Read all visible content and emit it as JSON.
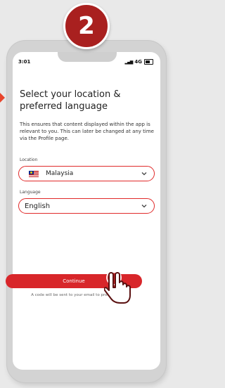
{
  "step_number": "2",
  "status_bar": {
    "time": "3:01",
    "network": "4G"
  },
  "title": "Select your location & preferred language",
  "description": "This ensures that content displayed within the app is relevant to you. This can later be changed at any time via the Profile page.",
  "location": {
    "label": "Location",
    "value": "Malaysia",
    "flag": "malaysia-flag"
  },
  "language": {
    "label": "Language",
    "value": "English"
  },
  "continue_button": {
    "label": "Continue"
  },
  "note": "A code will be sent to your email to proceed",
  "colors": {
    "accent": "#d8262a",
    "badge": "#a9201f"
  }
}
